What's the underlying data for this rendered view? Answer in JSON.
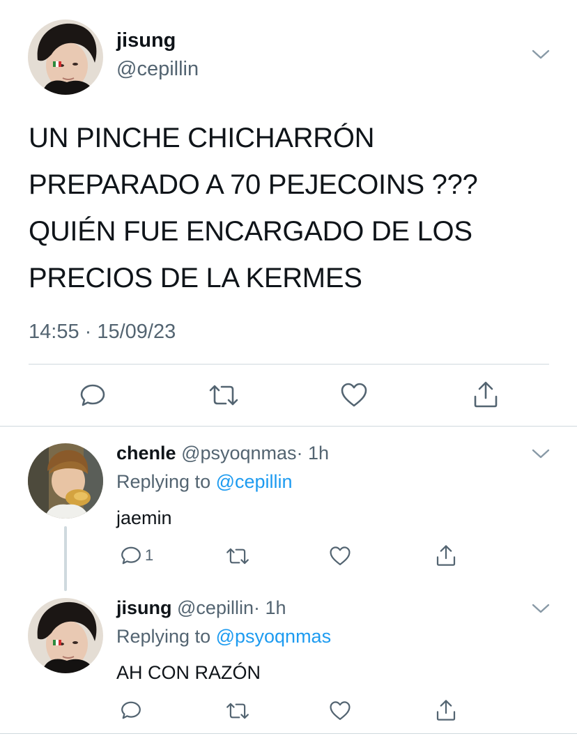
{
  "main_tweet": {
    "display_name": "jisung",
    "handle": "@cepillin",
    "text_lines": [
      "UN PINCHE CHICHARRÓN",
      "PREPARADO A 70 PEJECOINS ???",
      "QUIÉN FUE ENCARGADO DE LOS",
      "PRECIOS DE LA KERMES"
    ],
    "timestamp": "14:55 · 15/09/23",
    "actions": [
      "reply-icon",
      "retweet-icon",
      "like-icon",
      "share-icon"
    ]
  },
  "replies": [
    {
      "display_name": "chenle",
      "handle": "@psyoqnmas",
      "time": "· 1h",
      "replying_prefix": "Replying to ",
      "replying_to": "@cepillin",
      "text": "jaemin",
      "reply_count": "1"
    },
    {
      "display_name": "jisung",
      "handle": "@cepillin",
      "time": "· 1h",
      "replying_prefix": "Replying to ",
      "replying_to": "@psyoqnmas",
      "text": "AH CON RAZÓN",
      "reply_count": ""
    }
  ],
  "colors": {
    "text": "#0f1419",
    "secondary": "#536471",
    "link": "#1d9bf0",
    "divider": "#cfd9de"
  }
}
